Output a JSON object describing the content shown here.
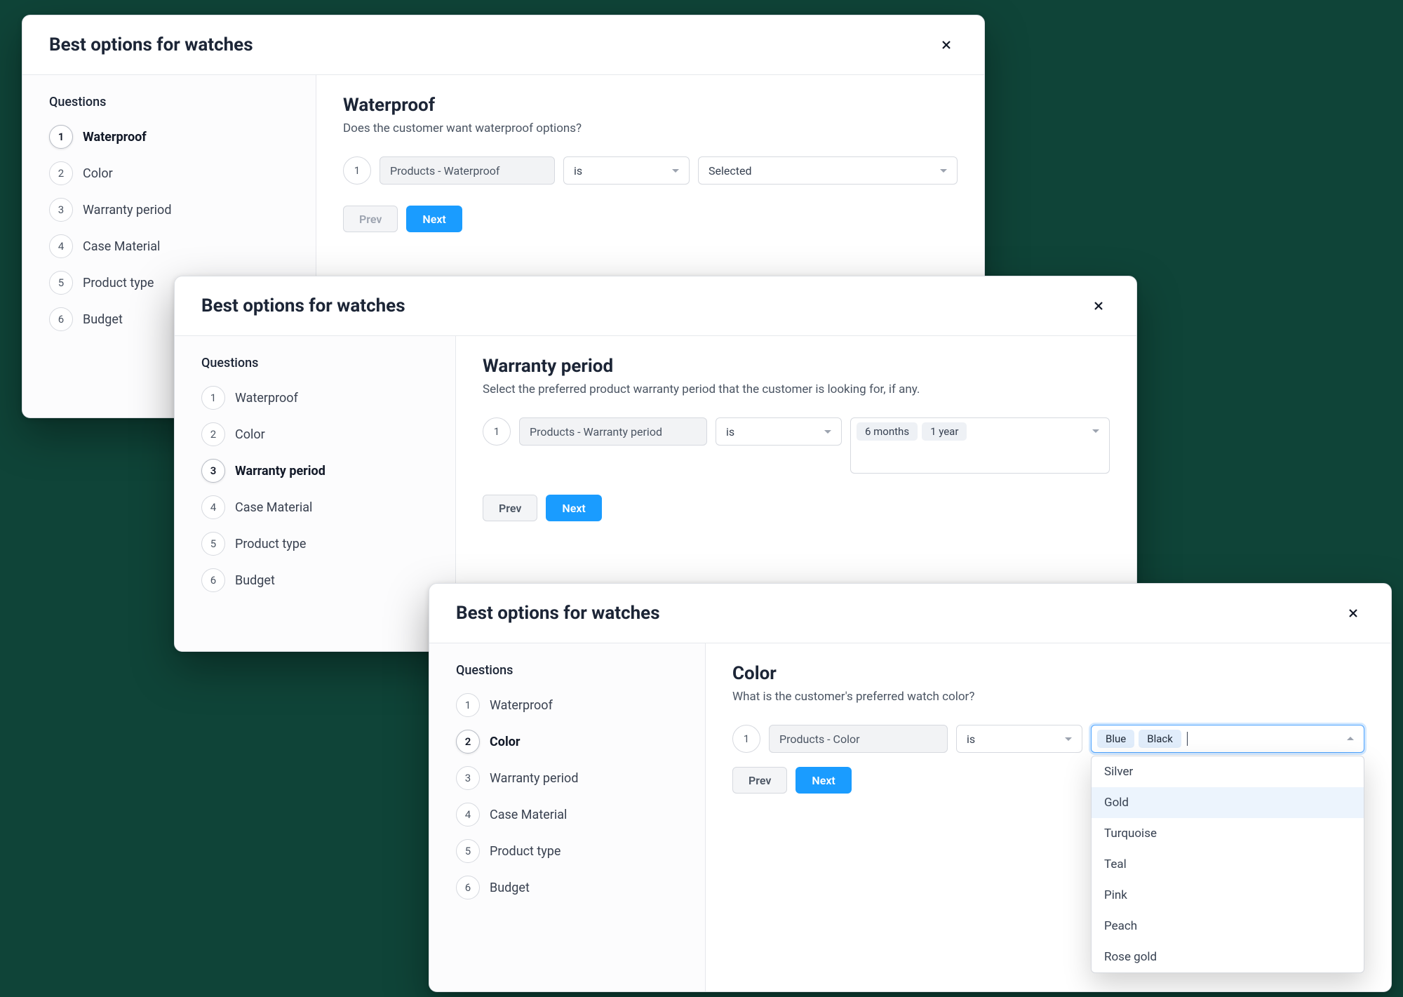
{
  "common": {
    "title": "Best options for watches",
    "sidebar_title": "Questions",
    "questions": [
      {
        "num": "1",
        "label": "Waterproof"
      },
      {
        "num": "2",
        "label": "Color"
      },
      {
        "num": "3",
        "label": "Warranty period"
      },
      {
        "num": "4",
        "label": "Case Material"
      },
      {
        "num": "5",
        "label": "Product type"
      },
      {
        "num": "6",
        "label": "Budget"
      }
    ],
    "prev_label": "Prev",
    "next_label": "Next",
    "rule_number": "1"
  },
  "dialog1": {
    "active_index": 0,
    "heading": "Waterproof",
    "description": "Does the customer want waterproof options?",
    "field": "Products - Waterproof",
    "operator": "is",
    "value": "Selected",
    "prev_disabled": true
  },
  "dialog2": {
    "active_index": 2,
    "heading": "Warranty period",
    "description": "Select the preferred product warranty period that the customer is looking for, if any.",
    "field": "Products - Warranty period",
    "operator": "is",
    "chips": [
      "6 months",
      "1 year"
    ],
    "prev_disabled": false
  },
  "dialog3": {
    "active_index": 1,
    "heading": "Color",
    "description": "What is the customer's preferred watch color?",
    "field": "Products - Color",
    "operator": "is",
    "chips": [
      "Blue",
      "Black"
    ],
    "dropdown_open": true,
    "dropdown_highlight_index": 1,
    "dropdown_options": [
      "Silver",
      "Gold",
      "Turquoise",
      "Teal",
      "Pink",
      "Peach",
      "Rose gold"
    ],
    "prev_disabled": false
  }
}
